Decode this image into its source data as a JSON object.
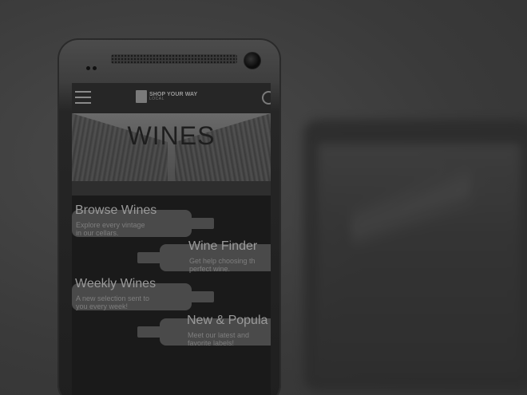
{
  "app": {
    "logo_main": "SHOP YOUR WAY",
    "logo_sub": "LOCAL"
  },
  "hero": {
    "title": "WINES"
  },
  "menu": [
    {
      "title": "Browse Wines",
      "desc_line1": "Explore every vintage",
      "desc_line2": "in our cellars."
    },
    {
      "title": "Wine Finder",
      "desc_line1": "Get help choosing th",
      "desc_line2": "perfect wine."
    },
    {
      "title": "Weekly Wines",
      "desc_line1": "A new selection sent to",
      "desc_line2": "you every week!"
    },
    {
      "title": "New & Popula",
      "desc_line1": "Meet our latest and",
      "desc_line2": "favorite labels!"
    }
  ],
  "icons": {
    "menu": "hamburger-menu-icon",
    "search": "search-icon",
    "logo": "shopping-bag-icon"
  },
  "colors": {
    "background": "#3a3a3a",
    "phone": "#1f1f1f",
    "bottle": "#4a4a4a",
    "text": "#9a9a9a"
  }
}
